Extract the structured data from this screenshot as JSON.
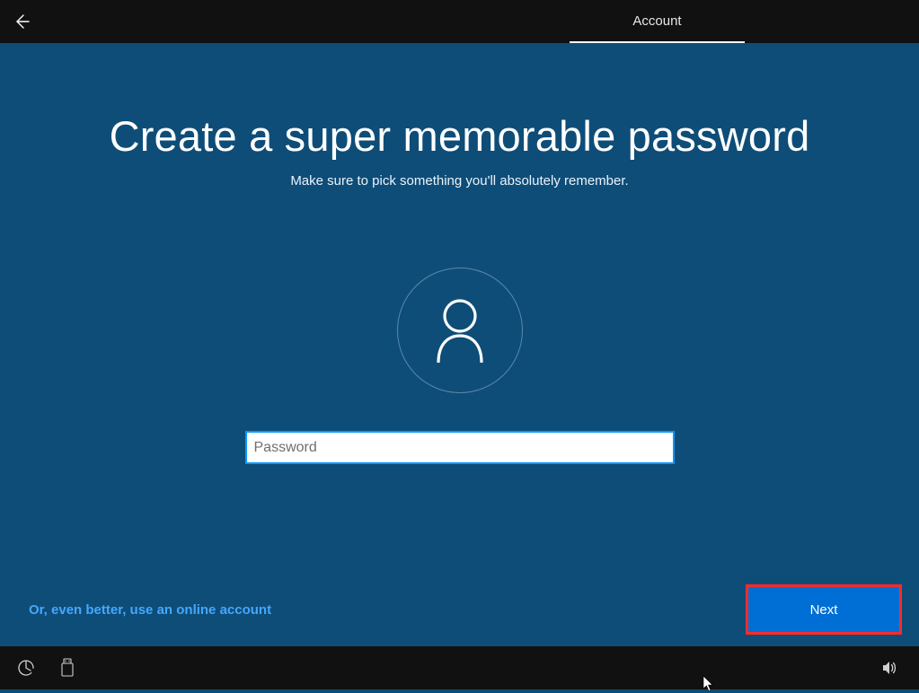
{
  "titlebar": {
    "tab_label": "Account"
  },
  "page": {
    "heading": "Create a super memorable password",
    "subheading": "Make sure to pick something you'll absolutely remember.",
    "password_placeholder": "Password",
    "online_account_link": "Or, even better, use an online account",
    "next_label": "Next"
  },
  "colors": {
    "background": "#0e4d78",
    "accent": "#0a99ff",
    "link": "#45a7ff",
    "button": "#006fd5",
    "highlight_outline": "#ff2a2a"
  },
  "icons": {
    "back": "arrow-left-icon",
    "avatar": "person-outline-icon",
    "ease_of_access": "ease-of-access-icon",
    "usb": "usb-device-icon",
    "volume": "volume-icon"
  }
}
